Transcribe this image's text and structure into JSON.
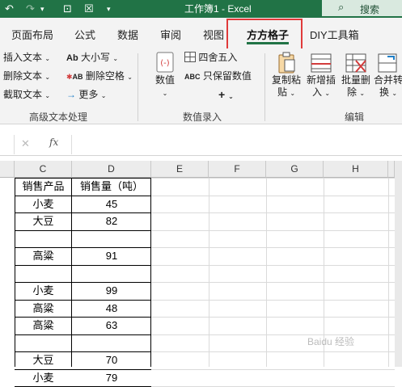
{
  "titlebar": {
    "title": "工作簿1 - Excel",
    "search_label": "搜索",
    "qa": [
      "↶",
      "↷",
      "▾",
      "⊡",
      "☒",
      "▾"
    ]
  },
  "tabs": [
    {
      "label": "页面布局",
      "name": "tab-page-layout"
    },
    {
      "label": "公式",
      "name": "tab-formulas"
    },
    {
      "label": "数据",
      "name": "tab-data"
    },
    {
      "label": "审阅",
      "name": "tab-review"
    },
    {
      "label": "视图",
      "name": "tab-view"
    },
    {
      "label": "方方格子",
      "name": "tab-fangfangezi"
    },
    {
      "label": "DIY工具箱",
      "name": "tab-diy-toolbox"
    }
  ],
  "ribbon": {
    "advanced_text": {
      "insert_text": "插入文本",
      "delete_text": "删除文本",
      "extract_text": "截取文本",
      "case_ab": "Ab",
      "case": "大小写",
      "delete_space_ab": "AB",
      "delete_space": "删除空格",
      "more": "更多",
      "group": "高级文本处理"
    },
    "numeric": {
      "numeric_big": "数值",
      "round": "四舍五入",
      "keep_value_abc": "ABC",
      "keep_value": "只保留数值",
      "plus": "+",
      "group": "数值录入"
    },
    "edit": {
      "copy_paste": "复制粘",
      "copy_paste2": "贴",
      "new_insert": "新增插",
      "new_insert2": "入",
      "batch_delete": "批量删",
      "batch_delete2": "除",
      "merge_convert": "合并转",
      "merge_convert2": "换",
      "group": "编辑"
    }
  },
  "formula_bar": {
    "cancel": "✕",
    "confirm": "✓",
    "fx": "fx"
  },
  "columns": [
    "C",
    "D",
    "E",
    "F",
    "G",
    "H"
  ],
  "table": {
    "header_product": "销售产品",
    "header_qty": "销售量（吨）",
    "rows": [
      {
        "product": "小麦",
        "qty": "45"
      },
      {
        "product": "大豆",
        "qty": "82"
      },
      {
        "product": "",
        "qty": ""
      },
      {
        "product": "高粱",
        "qty": "91"
      },
      {
        "product": "",
        "qty": ""
      },
      {
        "product": "小麦",
        "qty": "99"
      },
      {
        "product": "高粱",
        "qty": "48"
      },
      {
        "product": "高粱",
        "qty": "63"
      },
      {
        "product": "",
        "qty": ""
      },
      {
        "product": "大豆",
        "qty": "70"
      },
      {
        "product": "小麦",
        "qty": "79"
      }
    ]
  },
  "watermark": "Baidu 经验"
}
